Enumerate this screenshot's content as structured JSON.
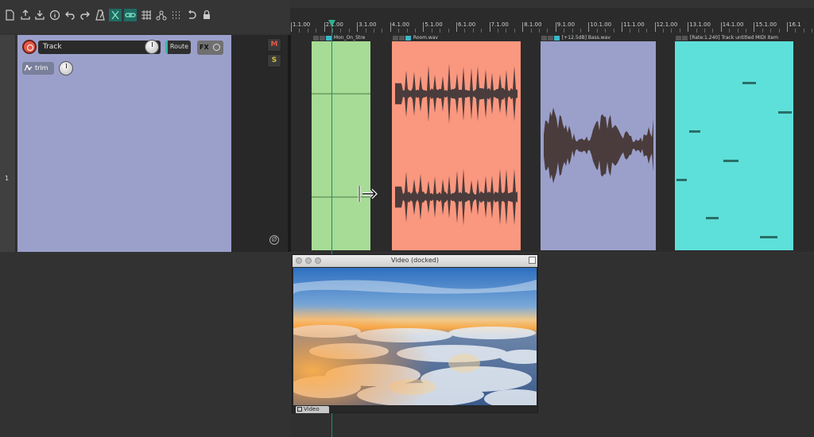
{
  "toolbar": {
    "icons": [
      "new-project",
      "open-project",
      "save-project",
      "project-settings",
      "undo",
      "redo",
      "metronome",
      "ripple-edit",
      "link",
      "grid",
      "group",
      "snap",
      "loop",
      "lock"
    ]
  },
  "ruler": {
    "labels": [
      "1.1.00",
      "2.1.00",
      "3.1.00",
      "4.1.00",
      "5.1.00",
      "6.1.00",
      "7.1.00",
      "8.1.00",
      "9.1.00",
      "10.1.00",
      "11.1.00",
      "12.1.00",
      "13.1.00",
      "14.1.00",
      "15.1.00",
      "16.1"
    ]
  },
  "track": {
    "number": "1",
    "name": "Track",
    "route_label": "Route",
    "fx_label": "FX",
    "trim_label": "trim",
    "mute_label": "M",
    "solo_label": "S",
    "phase_label": "Ø",
    "color": "#9ba0cb"
  },
  "items": [
    {
      "name": "Mon_On_Stre",
      "color": "#a7dc96"
    },
    {
      "name": "Room.wav",
      "color": "#fa977f"
    },
    {
      "name": "[+12.5dB] Bass.wav",
      "color": "#9ba0cb"
    },
    {
      "name": "[Rate:1.240] Track untitled MIDI item",
      "color": "#5de0d9"
    }
  ],
  "video_window": {
    "title": "Video (docked)",
    "tab_label": "Video"
  }
}
